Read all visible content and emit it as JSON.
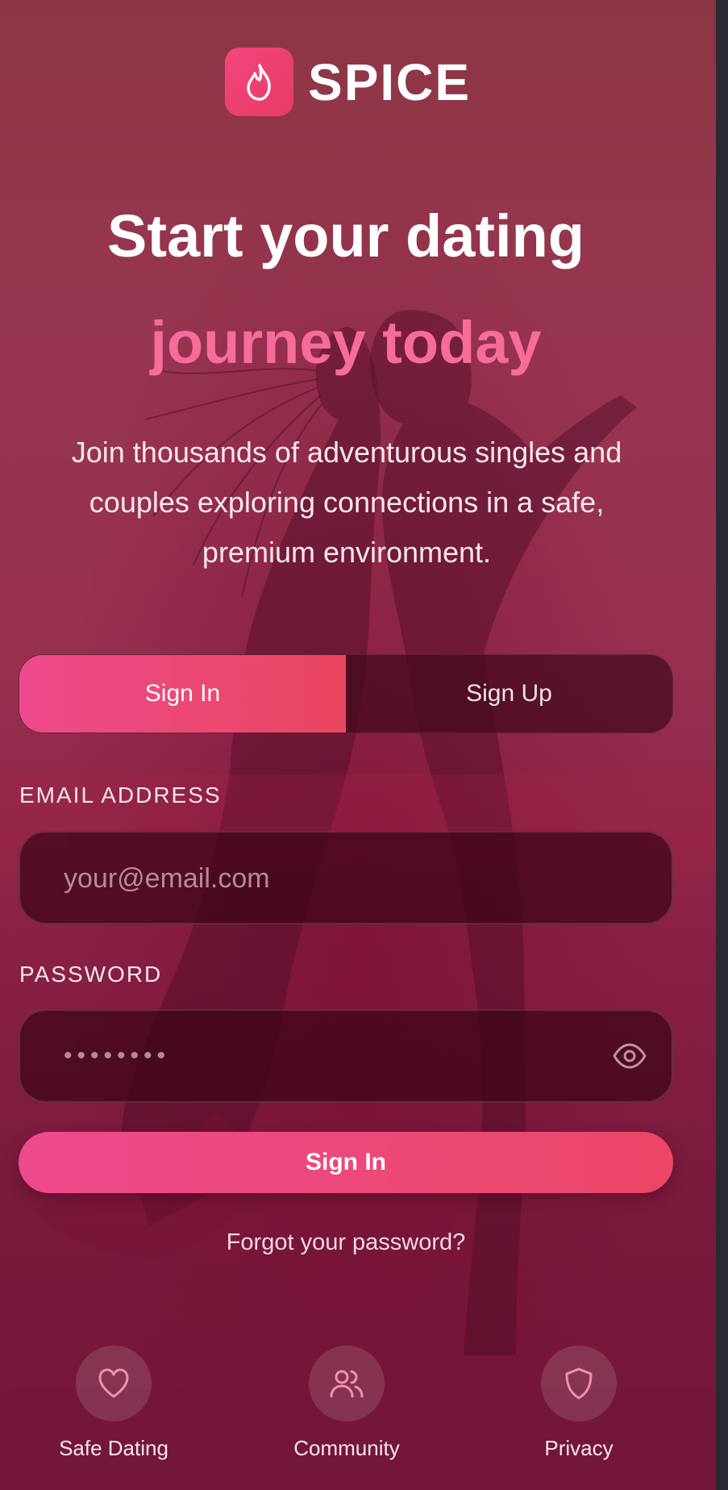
{
  "brand": {
    "name": "SPICE",
    "icon": "flame-icon",
    "accent": "#ec4a78"
  },
  "hero": {
    "title_line1": "Start your dating",
    "title_line2": "journey today",
    "subtitle": "Join thousands of adventurous singles and couples exploring connections in a safe, premium environment."
  },
  "auth_tabs": {
    "sign_in": "Sign In",
    "sign_up": "Sign Up",
    "active": "sign_in"
  },
  "form": {
    "email_label": "EMAIL ADDRESS",
    "email_placeholder": "your@email.com",
    "email_value": "",
    "password_label": "PASSWORD",
    "password_value_masked": "••••••••",
    "password_visibility_icon": "eye-icon",
    "submit_label": "Sign In",
    "forgot_label": "Forgot your password?"
  },
  "features": [
    {
      "label": "Safe Dating",
      "icon": "heart-icon"
    },
    {
      "label": "Community",
      "icon": "users-icon"
    },
    {
      "label": "Privacy",
      "icon": "shield-icon"
    }
  ],
  "colors": {
    "primary_gradient_start": "#ee4a8e",
    "primary_gradient_end": "#eb4666",
    "highlight_text": "#f76c9d"
  }
}
